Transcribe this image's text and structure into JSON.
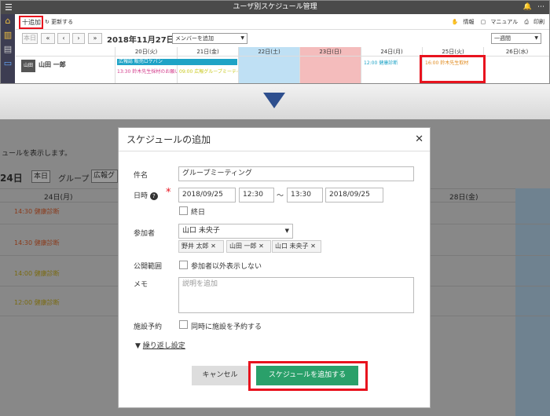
{
  "top": {
    "title": "ユーザ別スケジュール管理",
    "add": "十追加",
    "refresh": "更新する",
    "info": "情報",
    "manual": "マニュアル",
    "print": "印刷",
    "today": "本日",
    "date": "2018年11月27日",
    "member_select": "メンバーを追加",
    "week_select": "一週間",
    "user": "山田 一郎",
    "days": [
      "20日(火)",
      "21日(金)",
      "22日(土)",
      "23日(日)",
      "24日(月)",
      "25日(火)",
      "26日(水)"
    ],
    "events": {
      "e1": "広報誌 販売ロケバン",
      "e2": "13:30 鈴木先生採材のお願い",
      "e3": "09:00 広報グループミーティ",
      "e4": "12:00 健康診断",
      "e5": "16:00 鈴木先生取材"
    }
  },
  "bottom": {
    "desc": "ュールを表示します。",
    "date": "24日",
    "today": "本日",
    "group": "グループ",
    "group_val": "広報グ",
    "col1": "24日(月)",
    "col2": "28日(金)",
    "events": [
      "14:30 健康診断",
      "14:30 健康診断",
      "14:00 健康診断",
      "12:00 健康診断"
    ]
  },
  "modal": {
    "title": "スケジュールの追加",
    "subject_label": "件名",
    "subject_value": "グループミーティング",
    "datetime_label": "日時",
    "start_date": "2018/09/25",
    "start_time": "12:30",
    "tilde": "〜",
    "end_time": "13:30",
    "end_date": "2018/09/25",
    "allday": "終日",
    "participants_label": "参加者",
    "participant_select": "山口 未央子",
    "chips": [
      "野井 太郎",
      "山田 一郎",
      "山口 未央子"
    ],
    "visibility_label": "公開範囲",
    "visibility_option": "参加者以外表示しない",
    "memo_label": "メモ",
    "memo_placeholder": "説明を追加",
    "facility_label": "施設予約",
    "facility_option": "同時に施設を予約する",
    "repeat": "繰り返し設定",
    "cancel": "キャンセル",
    "submit": "スケジュールを追加する"
  }
}
